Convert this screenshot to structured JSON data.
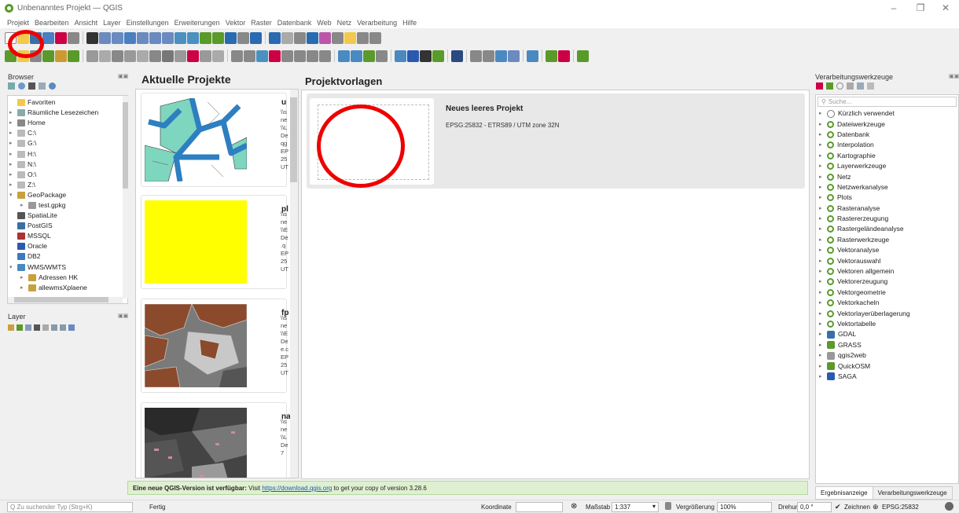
{
  "window": {
    "title": "Unbenanntes Projekt — QGIS"
  },
  "menu": [
    "Projekt",
    "Bearbeiten",
    "Ansicht",
    "Layer",
    "Einstellungen",
    "Erweiterungen",
    "Vektor",
    "Raster",
    "Datenbank",
    "Web",
    "Netz",
    "Verarbeitung",
    "Hilfe"
  ],
  "browser": {
    "title": "Browser",
    "items": [
      {
        "label": "Favoriten",
        "icon": "star-icon",
        "arrow": ""
      },
      {
        "label": "Räumliche Lesezeichen",
        "icon": "bookmark-icon",
        "arrow": "▸"
      },
      {
        "label": "Home",
        "icon": "home-icon",
        "arrow": "▸"
      },
      {
        "label": "C:\\",
        "icon": "drive-icon",
        "arrow": "▸"
      },
      {
        "label": "G:\\",
        "icon": "drive-icon",
        "arrow": "▸"
      },
      {
        "label": "H:\\",
        "icon": "drive-icon",
        "arrow": "▸"
      },
      {
        "label": "N:\\",
        "icon": "drive-icon",
        "arrow": "▸"
      },
      {
        "label": "O:\\",
        "icon": "drive-icon",
        "arrow": "▸"
      },
      {
        "label": "Z:\\",
        "icon": "drive-icon",
        "arrow": "▸"
      },
      {
        "label": "GeoPackage",
        "icon": "geopackage-icon",
        "arrow": "▾"
      },
      {
        "label": "test.gpkg",
        "icon": "db-icon",
        "arrow": "▸",
        "indent": true
      },
      {
        "label": "SpatiaLite",
        "icon": "feather-icon",
        "arrow": ""
      },
      {
        "label": "PostGIS",
        "icon": "elephant-icon",
        "arrow": ""
      },
      {
        "label": "MSSQL",
        "icon": "mssql-icon",
        "arrow": ""
      },
      {
        "label": "Oracle",
        "icon": "oracle-icon",
        "arrow": ""
      },
      {
        "label": "DB2",
        "icon": "db2-icon",
        "arrow": ""
      },
      {
        "label": "WMS/WMTS",
        "icon": "globe-icon",
        "arrow": "▾"
      },
      {
        "label": "Adressen HK",
        "icon": "service-icon",
        "arrow": "▸",
        "indent": true
      },
      {
        "label": "allewmsXplaene",
        "icon": "service-icon",
        "arrow": "▸",
        "indent": true
      }
    ]
  },
  "layers": {
    "title": "Layer"
  },
  "recent": {
    "title": "Aktuelle Projekte",
    "projects": [
      {
        "name": "u",
        "lines": [
          "\\\\s",
          "ne",
          "\\\\L",
          "De",
          "qg",
          "EP",
          "25",
          "UT"
        ]
      },
      {
        "name": "pl",
        "lines": [
          "\\\\s",
          "ne",
          "\\\\E",
          "De",
          ".q",
          "EP",
          "25",
          "UT"
        ]
      },
      {
        "name": "fp",
        "lines": [
          "\\\\s",
          "ne",
          "\\\\E",
          "De",
          "e.c",
          "EP",
          "25",
          "UT"
        ]
      },
      {
        "name": "na",
        "lines": [
          "\\\\s",
          "ne",
          "\\\\L",
          "De",
          "7",
          ""
        ]
      }
    ]
  },
  "templates": {
    "title": "Projektvorlagen",
    "item": {
      "name": "Neues leeres Projekt",
      "crs": "EPSG:25832 - ETRS89 / UTM zone 32N"
    }
  },
  "update": {
    "bold": "Eine neue QGIS-Version ist verfügbar:",
    "pre": " Visit ",
    "link": "https://download.qgis.org",
    "post": " to get your copy of version 3.28.6"
  },
  "processing": {
    "title": "Verarbeitungswerkzeuge",
    "search_placeholder": "Suche...",
    "items": [
      {
        "label": "Kürzlich verwendet",
        "icon": "clock-icon"
      },
      {
        "label": "Dateiwerkzeuge",
        "icon": "qgis-icon"
      },
      {
        "label": "Datenbank",
        "icon": "qgis-icon"
      },
      {
        "label": "Interpolation",
        "icon": "qgis-icon"
      },
      {
        "label": "Kartographie",
        "icon": "qgis-icon"
      },
      {
        "label": "Layerwerkzeuge",
        "icon": "qgis-icon"
      },
      {
        "label": "Netz",
        "icon": "qgis-icon"
      },
      {
        "label": "Netzwerkanalyse",
        "icon": "qgis-icon"
      },
      {
        "label": "Plots",
        "icon": "qgis-icon"
      },
      {
        "label": "Rasteranalyse",
        "icon": "qgis-icon"
      },
      {
        "label": "Rastererzeugung",
        "icon": "qgis-icon"
      },
      {
        "label": "Rastergeländeanalyse",
        "icon": "qgis-icon"
      },
      {
        "label": "Rasterwerkzeuge",
        "icon": "qgis-icon"
      },
      {
        "label": "Vektoranalyse",
        "icon": "qgis-icon"
      },
      {
        "label": "Vektorauswahl",
        "icon": "qgis-icon"
      },
      {
        "label": "Vektoren allgemein",
        "icon": "qgis-icon"
      },
      {
        "label": "Vektorerzeugung",
        "icon": "qgis-icon"
      },
      {
        "label": "Vektorgeometrie",
        "icon": "qgis-icon"
      },
      {
        "label": "Vektorkacheln",
        "icon": "qgis-icon"
      },
      {
        "label": "Vektorlayerüberlagerung",
        "icon": "qgis-icon"
      },
      {
        "label": "Vektortabelle",
        "icon": "qgis-icon"
      },
      {
        "label": "GDAL",
        "icon": "gdal-icon"
      },
      {
        "label": "GRASS",
        "icon": "grass-icon"
      },
      {
        "label": "qgis2web",
        "icon": "qgis2web-icon"
      },
      {
        "label": "QuickOSM",
        "icon": "quickosm-icon"
      },
      {
        "label": "SAGA",
        "icon": "saga-icon"
      }
    ],
    "tabs": [
      "Ergebnisanzeige",
      "Verarbeitungswerkzeuge"
    ]
  },
  "status": {
    "locator_placeholder": "Q  Zu suchender Typ (Strg+K)",
    "ready": "Fertig",
    "coord_label": "Koordinate",
    "scale_label": "Maßstab",
    "scale": "1:337",
    "magnifier_label": "Vergrößerung",
    "magnifier": "100%",
    "rotation_label": "Drehung",
    "rotation": "0,0 °",
    "render_label": "Zeichnen",
    "crs": "EPSG:25832"
  }
}
